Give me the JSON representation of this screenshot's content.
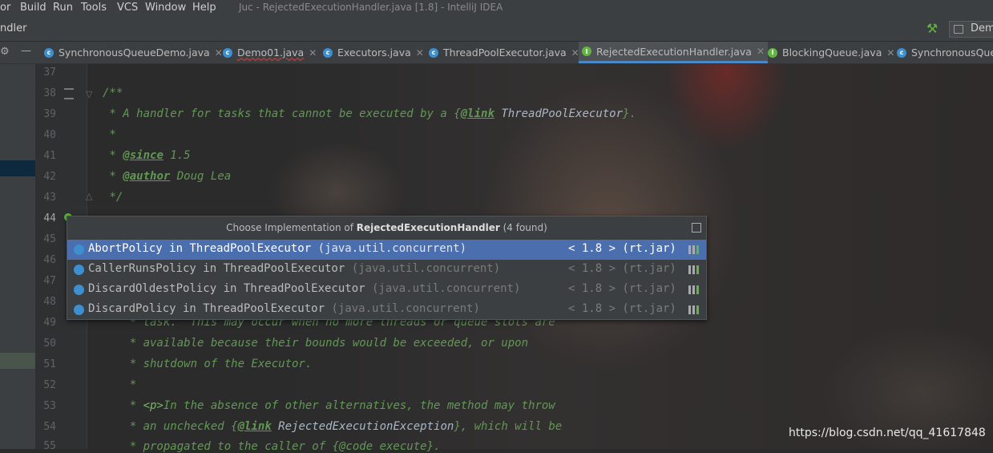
{
  "window": {
    "title": "Juc - RejectedExecutionHandler.java [1.8] - IntelliJ IDEA"
  },
  "menu": [
    "or",
    "Build",
    "Run",
    "Tools",
    "VCS",
    "Window",
    "Help"
  ],
  "nav": {
    "crumb": "ndler",
    "run_config": "Demo"
  },
  "tabs": [
    {
      "label": "SynchronousQueueDemo.java",
      "icon": "class-icon"
    },
    {
      "label": "Demo01.java",
      "icon": "class-icon"
    },
    {
      "label": "Executors.java",
      "icon": "class-icon"
    },
    {
      "label": "ThreadPoolExecutor.java",
      "icon": "class-icon"
    },
    {
      "label": "RejectedExecutionHandler.java",
      "icon": "interface-icon"
    },
    {
      "label": "BlockingQueue.java",
      "icon": "interface-icon"
    },
    {
      "label": "SynchronousQue",
      "icon": "class-icon"
    }
  ],
  "line_numbers": [
    "37",
    "38",
    "39",
    "40",
    "41",
    "42",
    "43",
    "44",
    "45",
    "46",
    "47",
    "48",
    "49",
    "50",
    "51",
    "52",
    "53",
    "54",
    "55"
  ],
  "code": {
    "l38": "/**",
    "l39_a": " * A handler for tasks that cannot be executed by a {",
    "l39_tag": "@link",
    "l39_b": " ThreadPoolExecutor",
    "l39_c": "}.",
    "l40": " *",
    "l41_a": " * ",
    "l41_tag": "@since",
    "l41_b": " 1.5",
    "l42_a": " * ",
    "l42_tag": "@author",
    "l42_b": " Doug Lea",
    "l43": " */",
    "l49": "    * task.  This may occur when no more threads or queue slots are",
    "l50": "    * available because their bounds would be exceeded, or upon",
    "l51": "    * shutdown of the Executor.",
    "l52": "    *",
    "l53_a": "    * ",
    "l53_tag": "<p>",
    "l53_b": "In the absence of other alternatives, the method may throw",
    "l54_a": "    * an unchecked {",
    "l54_tag": "@link",
    "l54_b": " RejectedExecutionException",
    "l54_c": "}, which will be",
    "l55": "    * propagated to the caller of {@code execute}."
  },
  "popup": {
    "title_prefix": "Choose Implementation of ",
    "title_bold": "RejectedExecutionHandler",
    "title_suffix": " (4 found)",
    "items": [
      {
        "cls": "AbortPolicy in ThreadPoolExecutor",
        "pkg": " (java.util.concurrent)",
        "jdk": "< 1.8 > (rt.jar)"
      },
      {
        "cls": "CallerRunsPolicy in ThreadPoolExecutor",
        "pkg": " (java.util.concurrent)",
        "jdk": "< 1.8 > (rt.jar)"
      },
      {
        "cls": "DiscardOldestPolicy in ThreadPoolExecutor",
        "pkg": " (java.util.concurrent)",
        "jdk": "< 1.8 > (rt.jar)"
      },
      {
        "cls": "DiscardPolicy in ThreadPoolExecutor",
        "pkg": " (java.util.concurrent)",
        "jdk": "< 1.8 > (rt.jar)"
      }
    ]
  },
  "watermark": "https://blog.csdn.net/qq_41617848"
}
